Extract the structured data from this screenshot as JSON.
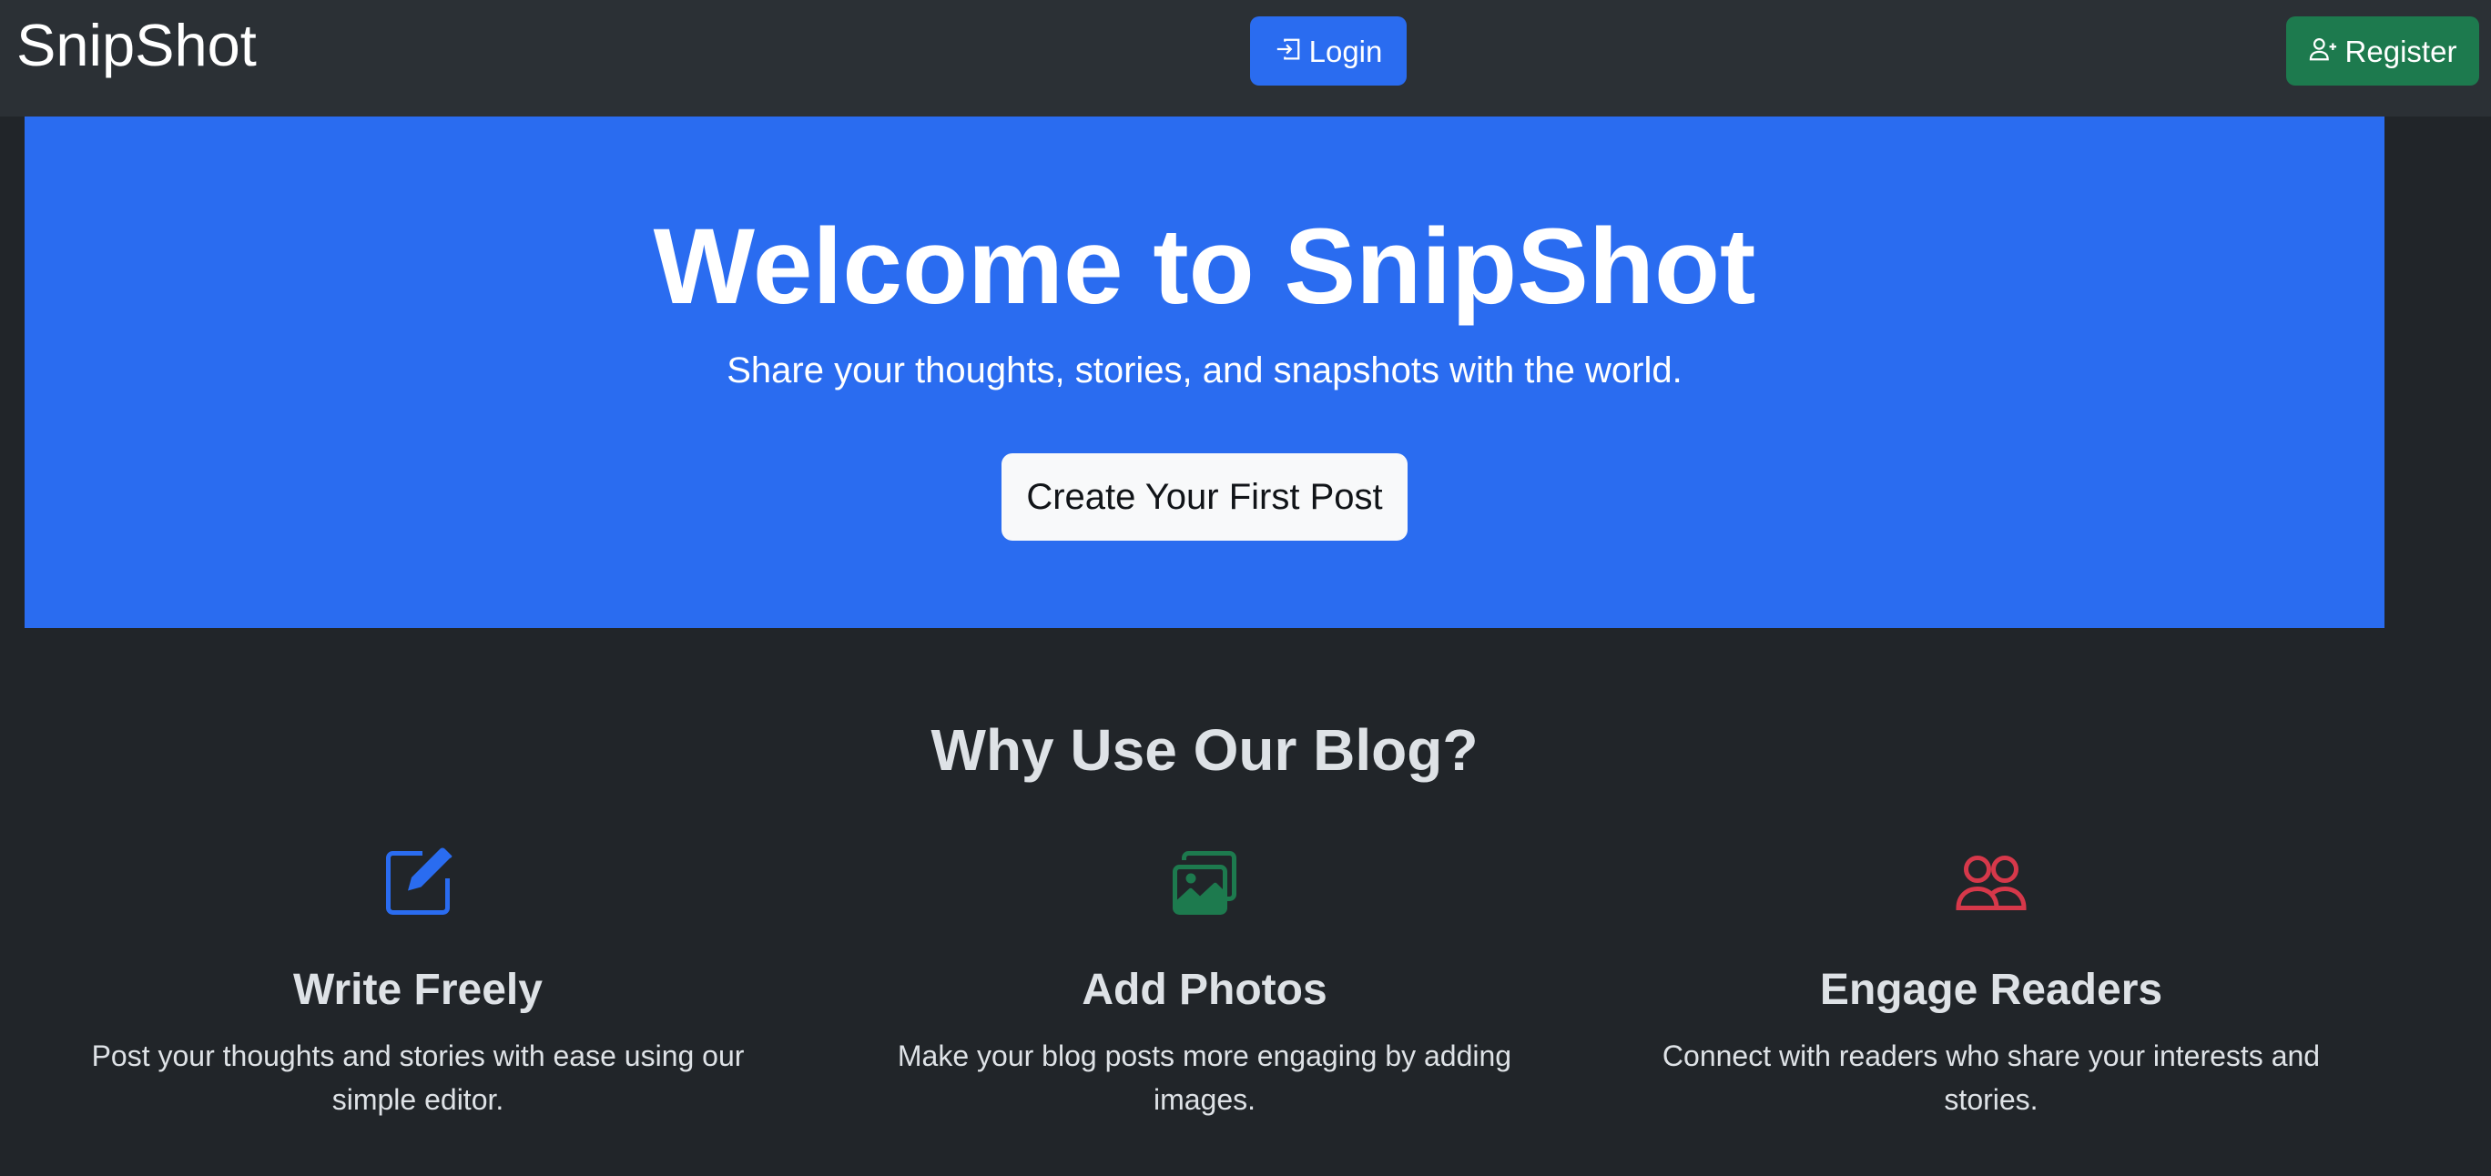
{
  "nav": {
    "brand": "SnipShot",
    "login_label": "Login",
    "register_label": "Register"
  },
  "hero": {
    "title": "Welcome to SnipShot",
    "subtitle": "Share your thoughts, stories, and snapshots with the world.",
    "cta_label": "Create Your First Post"
  },
  "features": {
    "heading": "Why Use Our Blog?",
    "items": [
      {
        "icon": "pencil-square-icon",
        "title": "Write Freely",
        "description": "Post your thoughts and stories with ease using our simple editor."
      },
      {
        "icon": "images-icon",
        "title": "Add Photos",
        "description": "Make your blog posts more engaging by adding images."
      },
      {
        "icon": "people-icon",
        "title": "Engage Readers",
        "description": "Connect with readers who share your interests and stories."
      }
    ]
  },
  "colors": {
    "page_bg": "#212529",
    "navbar_bg": "#2b3035",
    "primary": "#2a6cf0",
    "success": "#1d7a4e",
    "danger": "#d6384a",
    "light": "#f8f9fa"
  }
}
